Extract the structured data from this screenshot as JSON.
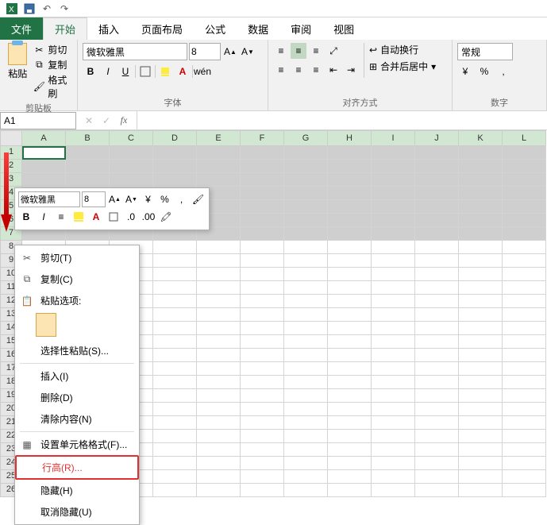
{
  "qat": {
    "save": "保存",
    "undo": "撤销",
    "redo": "恢复"
  },
  "tabs": {
    "file": "文件",
    "home": "开始",
    "insert": "插入",
    "layout": "页面布局",
    "formula": "公式",
    "data": "数据",
    "review": "审阅",
    "view": "视图"
  },
  "clipboard": {
    "paste": "粘贴",
    "cut": "剪切",
    "copy": "复制",
    "format_painter": "格式刷",
    "group": "剪贴板"
  },
  "font": {
    "name": "微软雅黑",
    "size": "8",
    "bold": "B",
    "italic": "I",
    "underline": "U",
    "ruby": "wén",
    "group": "字体"
  },
  "align": {
    "wrap": "自动换行",
    "merge": "合并后居中",
    "group": "对齐方式"
  },
  "number": {
    "format": "常规",
    "percent": "%",
    "comma": ",",
    "group": "数字"
  },
  "name_box": "A1",
  "columns": [
    "A",
    "B",
    "C",
    "D",
    "E",
    "F",
    "G",
    "H",
    "I",
    "J",
    "K",
    "L"
  ],
  "rows_visible": 26,
  "selected_rows_end": 7,
  "mini": {
    "font": "微软雅黑",
    "size": "8",
    "percent": "%",
    "comma": ",",
    "bold": "B",
    "italic": "I"
  },
  "ctx": {
    "cut": "剪切(T)",
    "copy": "复制(C)",
    "paste_options": "粘贴选项:",
    "paste_special": "选择性粘贴(S)...",
    "insert": "插入(I)",
    "delete": "删除(D)",
    "clear": "清除内容(N)",
    "format_cells": "设置单元格格式(F)...",
    "row_height": "行高(R)...",
    "hide": "隐藏(H)",
    "unhide": "取消隐藏(U)"
  }
}
